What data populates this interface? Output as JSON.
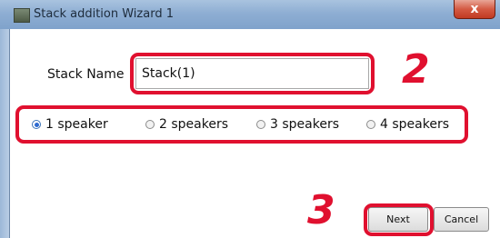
{
  "window": {
    "title": "Stack addition Wizard 1",
    "close_label": "x"
  },
  "form": {
    "stack_name_label": "Stack Name",
    "stack_name_value": "Stack(1)"
  },
  "speaker_options": [
    {
      "label": "1 speaker",
      "selected": true
    },
    {
      "label": "2 speakers",
      "selected": false
    },
    {
      "label": "3 speakers",
      "selected": false
    },
    {
      "label": "4 speakers",
      "selected": false
    }
  ],
  "buttons": {
    "next_label": "Next",
    "cancel_label": "Cancel"
  },
  "annotations": {
    "step2": "2",
    "step3": "3",
    "highlight_color": "#e0102f"
  }
}
